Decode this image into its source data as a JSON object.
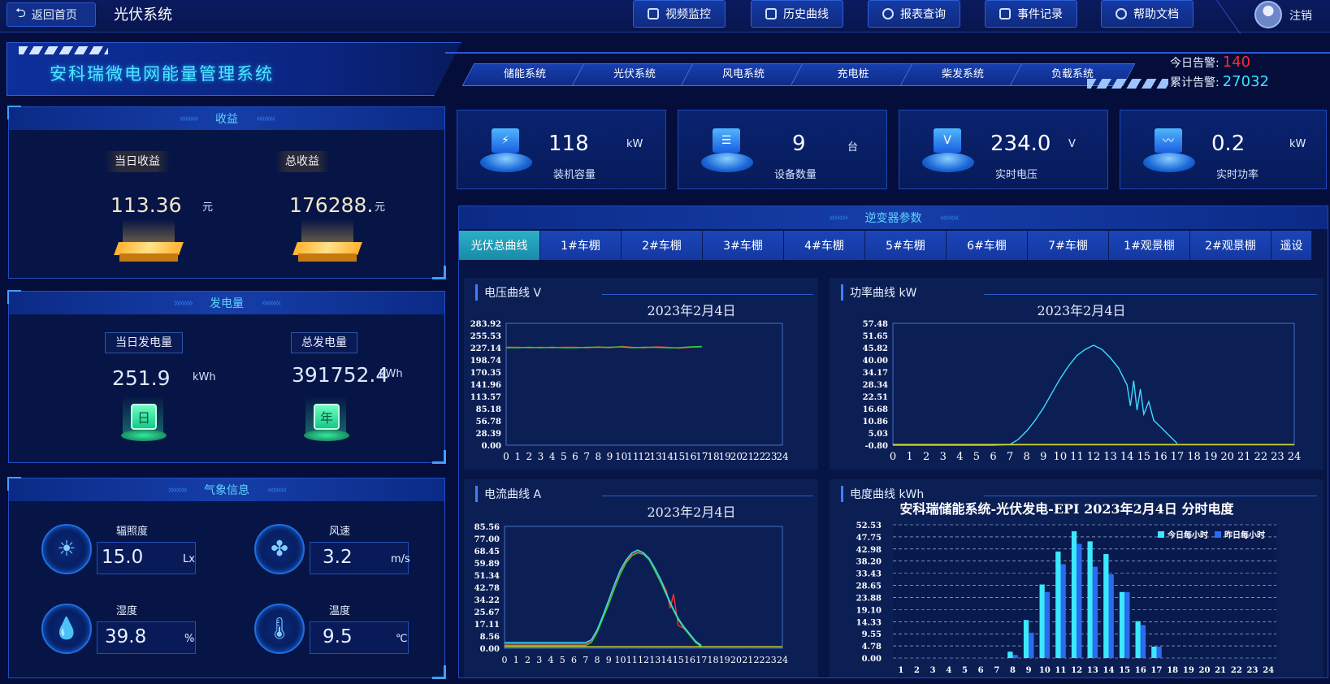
{
  "topbar": {
    "back_label": "返回首页",
    "system_title": "光伏系统",
    "nav": [
      "视频监控",
      "历史曲线",
      "报表查询",
      "事件记录",
      "帮助文档"
    ],
    "logout_label": "注销"
  },
  "header": {
    "title": "安科瑞微电网能量管理系统",
    "sub_tabs": [
      "储能系统",
      "光伏系统",
      "风电系统",
      "充电桩",
      "柴发系统",
      "负载系统"
    ],
    "today_alarm_label": "今日告警:",
    "today_alarm_value": "140",
    "total_alarm_label": "累计告警:",
    "total_alarm_value": "27032",
    "colors": {
      "today_alarm": "#ff2a2a",
      "total_alarm": "#36e6ff"
    }
  },
  "revenue": {
    "title": "收益",
    "today_label": "当日收益",
    "today_value": "113.36",
    "today_unit": "元",
    "total_label": "总收益",
    "total_value": "176288.",
    "total_unit": "元"
  },
  "generation": {
    "title": "发电量",
    "today_label": "当日发电量",
    "today_value": "251.9",
    "today_unit": "kWh",
    "total_label": "总发电量",
    "total_value": "391752.4",
    "total_unit": "kWh",
    "today_icon_text": "日",
    "total_icon_text": "年"
  },
  "weather": {
    "title": "气象信息",
    "items": [
      {
        "label": "辐照度",
        "value": "15.0",
        "unit": "Lx",
        "icon": "sun-icon"
      },
      {
        "label": "风速",
        "value": "3.2",
        "unit": "m/s",
        "icon": "fan-icon"
      },
      {
        "label": "湿度",
        "value": "39.8",
        "unit": "%",
        "icon": "droplet-icon"
      },
      {
        "label": "温度",
        "value": "9.5",
        "unit": "℃",
        "icon": "thermometer-icon"
      }
    ]
  },
  "stats": [
    {
      "value": "118",
      "unit": "kW",
      "label": "装机容量",
      "icon": "battery-icon"
    },
    {
      "value": "9",
      "unit": "台",
      "label": "设备数量",
      "icon": "device-icon"
    },
    {
      "value": "234.0",
      "unit": "V",
      "label": "实时电压",
      "icon": "meter-icon"
    },
    {
      "value": "0.2",
      "unit": "kW",
      "label": "实时功率",
      "icon": "pulse-icon"
    }
  ],
  "inverter": {
    "title": "逆变器参数",
    "tabs": [
      "光伏总曲线",
      "1#车棚",
      "2#车棚",
      "3#车棚",
      "4#车棚",
      "5#车棚",
      "6#车棚",
      "7#车棚",
      "1#观景棚",
      "2#观景棚",
      "遥设"
    ],
    "active_tab": 0
  },
  "chart_data": [
    {
      "type": "line",
      "panel_title": "电压曲线  V",
      "title": "2023年2月4日",
      "x_ticks": [
        "0",
        "1",
        "2",
        "3",
        "4",
        "5",
        "6",
        "7",
        "8",
        "9",
        "10",
        "11",
        "12",
        "13",
        "14",
        "15",
        "16",
        "17",
        "18",
        "19",
        "20",
        "21",
        "22",
        "23",
        "24"
      ],
      "y_ticks": [
        "283.92",
        "255.53",
        "227.14",
        "198.74",
        "170.35",
        "141.96",
        "113.57",
        "85.18",
        "56.78",
        "28.39",
        "0.00"
      ],
      "ylim": [
        0,
        283.92
      ],
      "xlim": [
        0,
        24
      ],
      "series": [
        {
          "color": "#ff3030",
          "x": [
            0,
            1,
            2,
            3,
            4,
            5,
            6,
            7,
            8,
            9,
            10,
            11,
            12,
            13,
            14,
            15,
            16,
            17
          ],
          "y": [
            228,
            228,
            227,
            228,
            227,
            228,
            228,
            227,
            229,
            227,
            230,
            228,
            227,
            229,
            228,
            226,
            228,
            229
          ]
        },
        {
          "color": "#30d030",
          "x": [
            0,
            1,
            2,
            3,
            4,
            5,
            6,
            7,
            8,
            9,
            10,
            11,
            12,
            13,
            14,
            15,
            16,
            17
          ],
          "y": [
            227,
            227,
            228,
            227,
            228,
            227,
            227,
            228,
            228,
            228,
            229,
            227,
            228,
            228,
            227,
            227,
            229,
            230
          ]
        }
      ]
    },
    {
      "type": "line",
      "panel_title": "功率曲线  kW",
      "title": "2023年2月4日",
      "x_ticks": [
        "0",
        "1",
        "2",
        "3",
        "4",
        "5",
        "6",
        "7",
        "8",
        "9",
        "10",
        "11",
        "12",
        "13",
        "14",
        "15",
        "16",
        "17",
        "18",
        "19",
        "20",
        "21",
        "22",
        "23",
        "24"
      ],
      "y_ticks": [
        "57.48",
        "51.65",
        "45.82",
        "40.00",
        "34.17",
        "28.34",
        "22.51",
        "16.68",
        "10.86",
        "5.03",
        "-0.80"
      ],
      "ylim": [
        -0.8,
        57.48
      ],
      "xlim": [
        0,
        24
      ],
      "series": [
        {
          "color": "#40d8ff",
          "x": [
            0,
            6,
            7,
            7.5,
            8,
            8.5,
            9,
            9.5,
            10,
            10.5,
            11,
            11.5,
            12,
            12.5,
            13,
            13.5,
            14,
            14.2,
            14.4,
            14.6,
            14.8,
            15,
            15.3,
            15.6,
            16,
            16.5,
            17
          ],
          "y": [
            -0.8,
            -0.8,
            -0.5,
            2,
            6,
            11,
            17,
            24,
            31,
            37,
            42,
            45,
            47,
            45,
            41,
            36,
            28,
            18,
            30,
            16,
            26,
            14,
            20,
            11,
            8,
            4,
            0
          ]
        },
        {
          "color": "#e0e020",
          "x": [
            0,
            24
          ],
          "y": [
            -0.5,
            -0.5
          ]
        }
      ]
    },
    {
      "type": "line",
      "panel_title": "电流曲线  A",
      "title": "2023年2月4日",
      "x_ticks": [
        "0",
        "1",
        "2",
        "3",
        "4",
        "5",
        "6",
        "7",
        "8",
        "9",
        "10",
        "11",
        "12",
        "13",
        "14",
        "15",
        "16",
        "17",
        "18",
        "19",
        "20",
        "21",
        "22",
        "23",
        "24"
      ],
      "y_ticks": [
        "85.56",
        "77.00",
        "68.45",
        "59.89",
        "51.34",
        "42.78",
        "34.22",
        "25.67",
        "17.11",
        "8.56",
        "0.00"
      ],
      "ylim": [
        0,
        85.56
      ],
      "xlim": [
        0,
        24
      ],
      "series": [
        {
          "color": "#ff3030",
          "x": [
            0,
            7,
            7.5,
            8,
            8.5,
            9,
            9.5,
            10,
            10.5,
            11,
            11.5,
            12,
            12.5,
            13,
            13.5,
            14,
            14.3,
            14.6,
            15,
            15.5,
            16,
            16.5,
            17
          ],
          "y": [
            3,
            3,
            5,
            12,
            22,
            32,
            43,
            53,
            61,
            66,
            68,
            67,
            63,
            55,
            48,
            40,
            28,
            38,
            16,
            14,
            9,
            5,
            1
          ]
        },
        {
          "color": "#30d030",
          "x": [
            0,
            7,
            7.5,
            8,
            8.5,
            9,
            9.5,
            10,
            10.5,
            11,
            11.5,
            12,
            12.5,
            13,
            13.5,
            14,
            14.5,
            15,
            15.5,
            16,
            16.5,
            17
          ],
          "y": [
            2,
            2,
            4,
            11,
            21,
            31,
            42,
            52,
            60,
            65,
            67,
            66,
            62,
            54,
            46,
            37,
            28,
            20,
            14,
            9,
            4,
            1
          ]
        },
        {
          "color": "#40d8ff",
          "x": [
            0,
            7,
            7.5,
            8,
            8.5,
            9,
            9.5,
            10,
            10.5,
            11,
            11.5,
            12,
            12.5,
            13,
            13.5,
            14,
            14.5,
            15,
            15.5,
            16,
            16.5,
            17
          ],
          "y": [
            4,
            4,
            6,
            13,
            23,
            34,
            45,
            55,
            62,
            67,
            69,
            67,
            63,
            56,
            48,
            38,
            29,
            21,
            15,
            10,
            5,
            2
          ]
        },
        {
          "color": "#e0e020",
          "x": [
            0,
            24
          ],
          "y": [
            1,
            1
          ]
        }
      ]
    },
    {
      "type": "bar",
      "panel_title": "电度曲线  kWh",
      "title": "安科瑞储能系统-光伏发电-EPI 2023年2月4日 分时电度",
      "categories": [
        "1",
        "2",
        "3",
        "4",
        "5",
        "6",
        "7",
        "8",
        "9",
        "10",
        "11",
        "12",
        "13",
        "14",
        "15",
        "16",
        "17",
        "18",
        "19",
        "20",
        "21",
        "22",
        "23",
        "24"
      ],
      "y_ticks": [
        "52.53",
        "47.75",
        "42.98",
        "38.20",
        "33.43",
        "28.65",
        "23.88",
        "19.10",
        "14.33",
        "9.55",
        "4.78",
        "0.00"
      ],
      "ylim": [
        0,
        52.53
      ],
      "legend": [
        "今日每小时",
        "昨日每小时"
      ],
      "series": [
        {
          "name": "今日每小时",
          "color": "#3ce8ff",
          "values": [
            0,
            0,
            0,
            0,
            0,
            0,
            0,
            2.5,
            15,
            29,
            42,
            50,
            46,
            41,
            26,
            14.5,
            4.5,
            0,
            0,
            0,
            0,
            0,
            0,
            0
          ]
        },
        {
          "name": "昨日每小时",
          "color": "#2a6cf0",
          "values": [
            0,
            0,
            0,
            0,
            0,
            0,
            0,
            1.2,
            10,
            26,
            37,
            45,
            36,
            33,
            26,
            13,
            4.5,
            0,
            0,
            0,
            0,
            0,
            0,
            0
          ]
        }
      ]
    }
  ]
}
